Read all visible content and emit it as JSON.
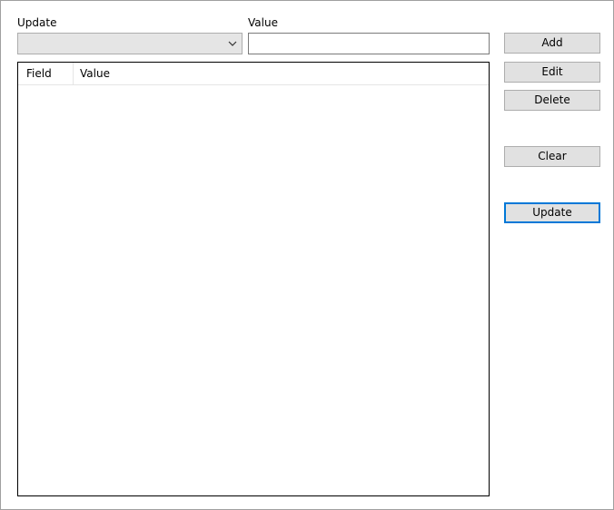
{
  "form": {
    "update_label": "Update",
    "update_selected": "",
    "value_label": "Value",
    "value_input": ""
  },
  "list": {
    "columns": [
      "Field",
      "Value"
    ],
    "rows": []
  },
  "buttons": {
    "add": "Add",
    "edit": "Edit",
    "delete": "Delete",
    "clear": "Clear",
    "update": "Update"
  },
  "colors": {
    "button_face": "#e1e1e1",
    "focus_border": "#0078d7",
    "combo_face": "#e5e5e5"
  },
  "icons": {
    "combo_arrow": "chevron-down-icon"
  }
}
